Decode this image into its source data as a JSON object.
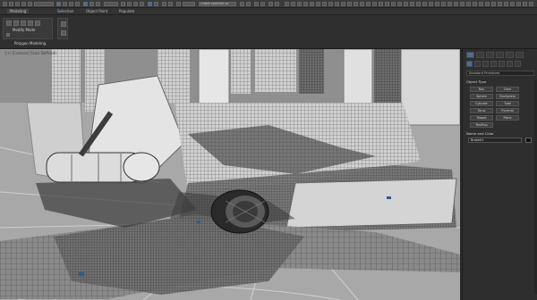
{
  "ribbon": {
    "tabs": [
      "Modeling",
      "Selection",
      "Object Paint",
      "Populate"
    ],
    "panel_label": "Modify Mode",
    "group_label": "Polygon Modeling"
  },
  "toolbar": {
    "selection_set": "Create Selection Se"
  },
  "viewport": {
    "label": "[+] [Camera] [User Defined]"
  },
  "command_panel": {
    "category": "Standard Primitives",
    "object_type_title": "Object Type",
    "primitives": [
      "Box",
      "Cone",
      "Sphere",
      "GeoSphere",
      "Cylinder",
      "Tube",
      "Torus",
      "Pyramid",
      "Teapot",
      "Plane",
      "TextPlus"
    ],
    "name_color_title": "Name and Color",
    "name_value": "Brake01"
  },
  "colors": {
    "accent": "#3d6faa",
    "ui_dark": "#2e2e2e",
    "viewport_bg": "#9c9c9c"
  }
}
